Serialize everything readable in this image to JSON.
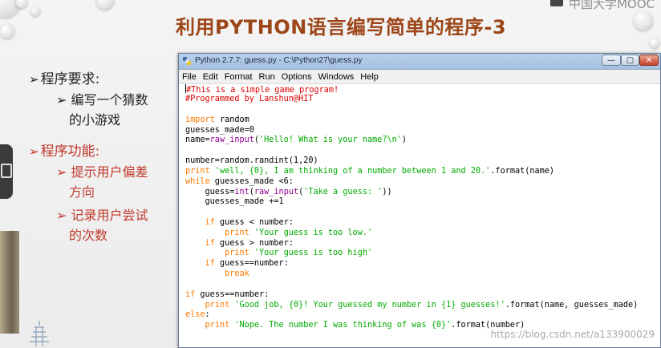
{
  "slide": {
    "title": "利用PYTHON语言编写简单的程序-3",
    "watermark_top": "中国大学MOOC",
    "watermark_bottom": "https://blog.csdn.net/a133900029",
    "bullets": [
      {
        "label": "程序要求:",
        "color": "#222222",
        "sub": [
          "编写一个猜数",
          "的小游戏"
        ]
      },
      {
        "label": "程序功能:",
        "color": "#c0392b",
        "sub": [
          "提示用户偏差",
          "方向",
          "记录用户尝试",
          "的次数"
        ]
      }
    ]
  },
  "window": {
    "title": "Python 2.7.7: guess.py - C:\\Python27\\guess.py",
    "buttons": {
      "minimize": "—",
      "maximize": "▢",
      "close": "✕"
    },
    "menu": [
      "File",
      "Edit",
      "Format",
      "Run",
      "Options",
      "Windows",
      "Help"
    ]
  },
  "code": {
    "lines": [
      "#This is a simple game program!",
      "#Programmed by Lanshun@HIT",
      "",
      "import random",
      "guesses_made=0",
      "name=raw_input('Hello! What is your name?\\n')",
      "",
      "number=random.randint(1,20)",
      "print 'well, {0}, I am thinking of a number between 1 and 20.'.format(name)",
      "while guesses_made <6:",
      "    guess=int(raw_input('Take a guess: '))",
      "    guesses_made +=1",
      "",
      "    if guess < number:",
      "        print 'Your guess is too low.'",
      "    if guess > number:",
      "        print 'Your guess is too high'",
      "    if guess==number:",
      "        break",
      "",
      "if guess==number:",
      "    print 'Good job, {0}! Your guessed my number in {1} guesses!'.format(name, guesses_made)",
      "else:",
      "    print 'Nope. The number I was thinking of was {0}'.format(number)"
    ]
  }
}
